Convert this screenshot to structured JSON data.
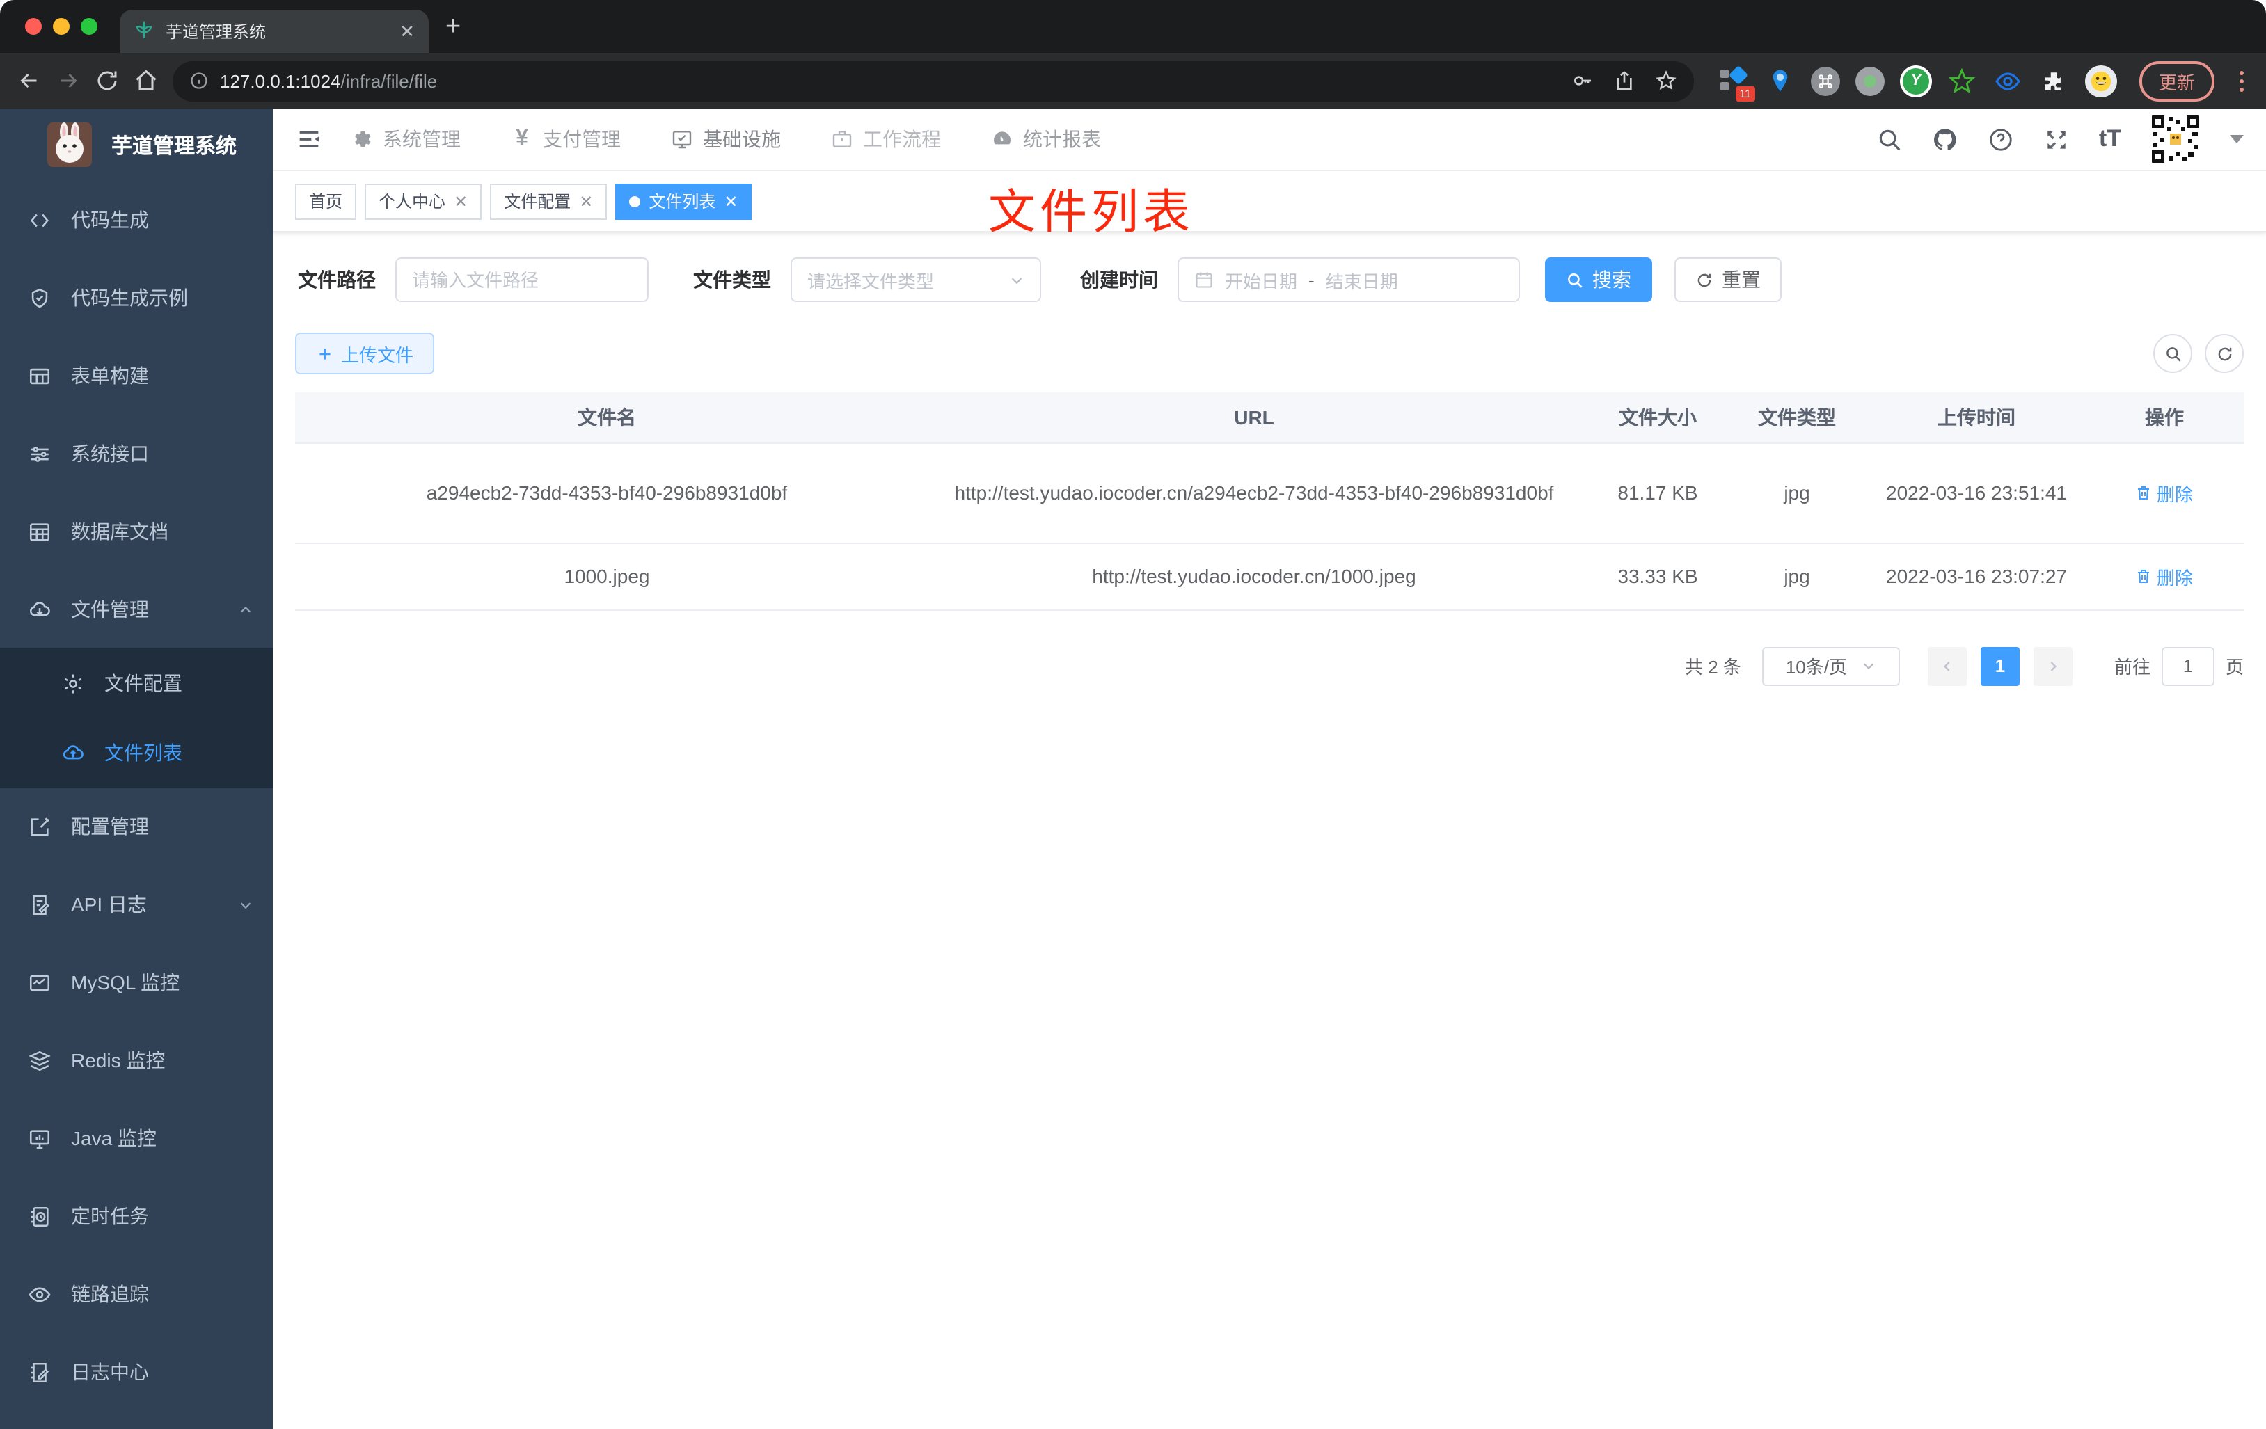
{
  "colors": {
    "accent": "#409eff",
    "annotation_red": "#f9290e",
    "sidebar_bg": "#304156",
    "submenu_bg": "#1f2d3d"
  },
  "browser": {
    "tab_title": "芋道管理系统",
    "url_host": "127.0.0.1:1024",
    "url_path": "/infra/file/file",
    "ext_badge": "11",
    "update_label": "更新"
  },
  "sidebar": {
    "logo_title": "芋道管理系统",
    "items": [
      "代码生成",
      "代码生成示例",
      "表单构建",
      "系统接口",
      "数据库文档",
      "文件管理",
      "配置管理",
      "API 日志",
      "MySQL 监控",
      "Redis 监控",
      "Java 监控",
      "定时任务",
      "链路追踪",
      "日志中心"
    ],
    "submenu": [
      "文件配置",
      "文件列表"
    ]
  },
  "header": {
    "nav": [
      "系统管理",
      "支付管理",
      "基础设施",
      "工作流程",
      "统计报表"
    ],
    "text_size_label": "tT"
  },
  "tags": [
    "首页",
    "个人中心",
    "文件配置",
    "文件列表"
  ],
  "annotation": "文件列表",
  "filter": {
    "path_label": "文件路径",
    "path_placeholder": "请输入文件路径",
    "type_label": "文件类型",
    "type_placeholder": "请选择文件类型",
    "time_label": "创建时间",
    "start_placeholder": "开始日期",
    "range_separator": "-",
    "end_placeholder": "结束日期",
    "search_label": "搜索",
    "reset_label": "重置"
  },
  "actions": {
    "upload_label": "上传文件"
  },
  "table": {
    "columns": [
      "文件名",
      "URL",
      "文件大小",
      "文件类型",
      "上传时间",
      "操作"
    ],
    "rows": [
      {
        "name": "a294ecb2-73dd-4353-bf40-296b8931d0bf",
        "url": "http://test.yudao.iocoder.cn/a294ecb2-73dd-4353-bf40-296b8931d0bf",
        "size": "81.17 KB",
        "type": "jpg",
        "time": "2022-03-16 23:51:41",
        "action": "删除"
      },
      {
        "name": "1000.jpeg",
        "url": "http://test.yudao.iocoder.cn/1000.jpeg",
        "size": "33.33 KB",
        "type": "jpg",
        "time": "2022-03-16 23:07:27",
        "action": "删除"
      }
    ]
  },
  "pagination": {
    "total": "共 2 条",
    "page_size": "10条/页",
    "current": "1",
    "goto_label": "前往",
    "goto_value": "1",
    "page_unit": "页"
  }
}
